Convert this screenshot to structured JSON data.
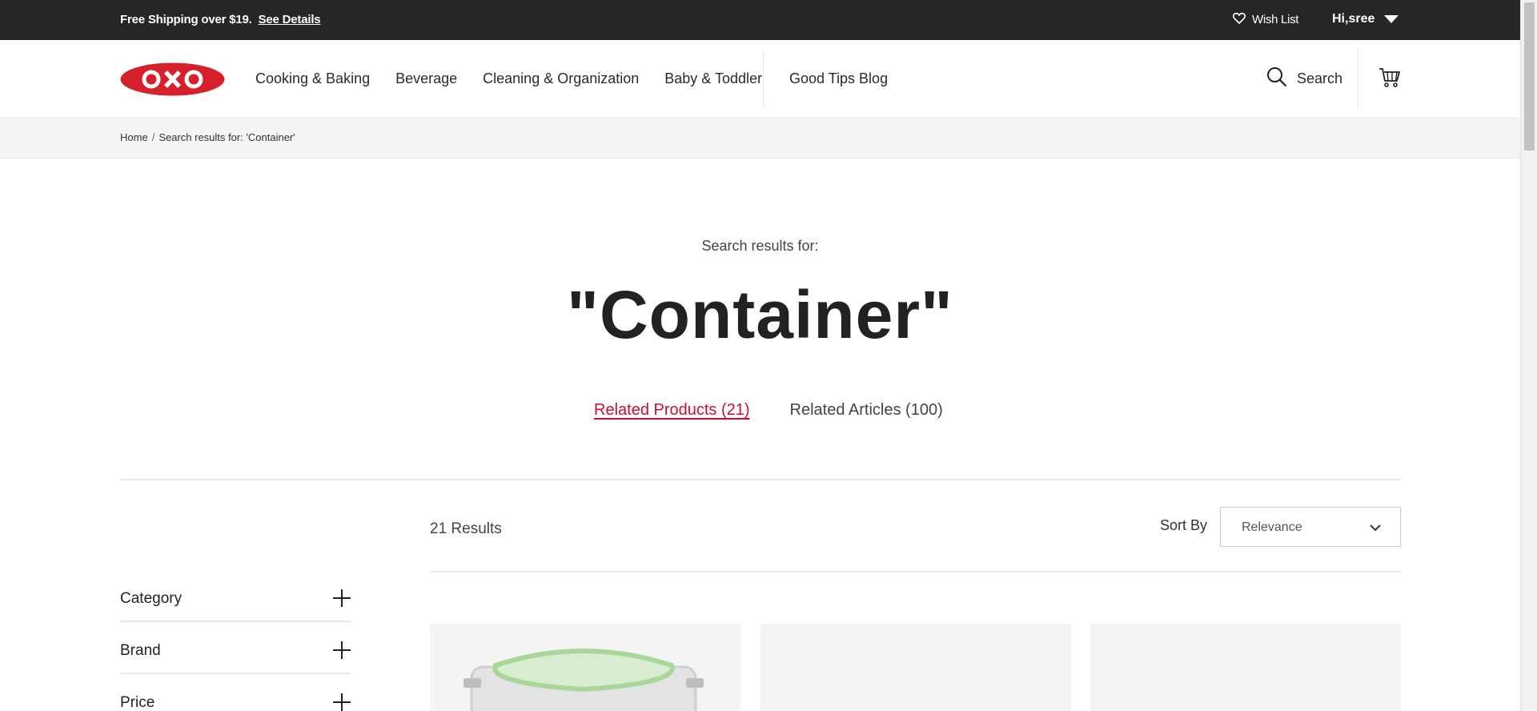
{
  "promo": {
    "text": "Free Shipping over $19.",
    "link": "See Details"
  },
  "utility": {
    "wishlist": "Wish List",
    "user": "Hi,sree"
  },
  "logo": {
    "text": "OXO",
    "color": "#d6202c"
  },
  "nav": {
    "items": [
      "Cooking & Baking",
      "Beverage",
      "Cleaning & Organization",
      "Baby & Toddler"
    ],
    "blog": "Good Tips Blog"
  },
  "search": {
    "label": "Search"
  },
  "breadcrumb": {
    "home": "Home",
    "sep": "/",
    "current": "Search results for: 'Container'"
  },
  "results_header": {
    "label": "Search results for:",
    "query": "\"Container\"",
    "tabs": [
      {
        "label": "Related Products (21)",
        "active": true
      },
      {
        "label": "Related Articles (100)",
        "active": false
      }
    ]
  },
  "results": {
    "count": "21 Results",
    "sort_label": "Sort By",
    "sort_value": "Relevance"
  },
  "filters": [
    "Category",
    "Brand",
    "Price"
  ],
  "colors": {
    "accent": "#c8102e",
    "promo_bg": "#262626",
    "card_bg": "#f4f4f4"
  }
}
